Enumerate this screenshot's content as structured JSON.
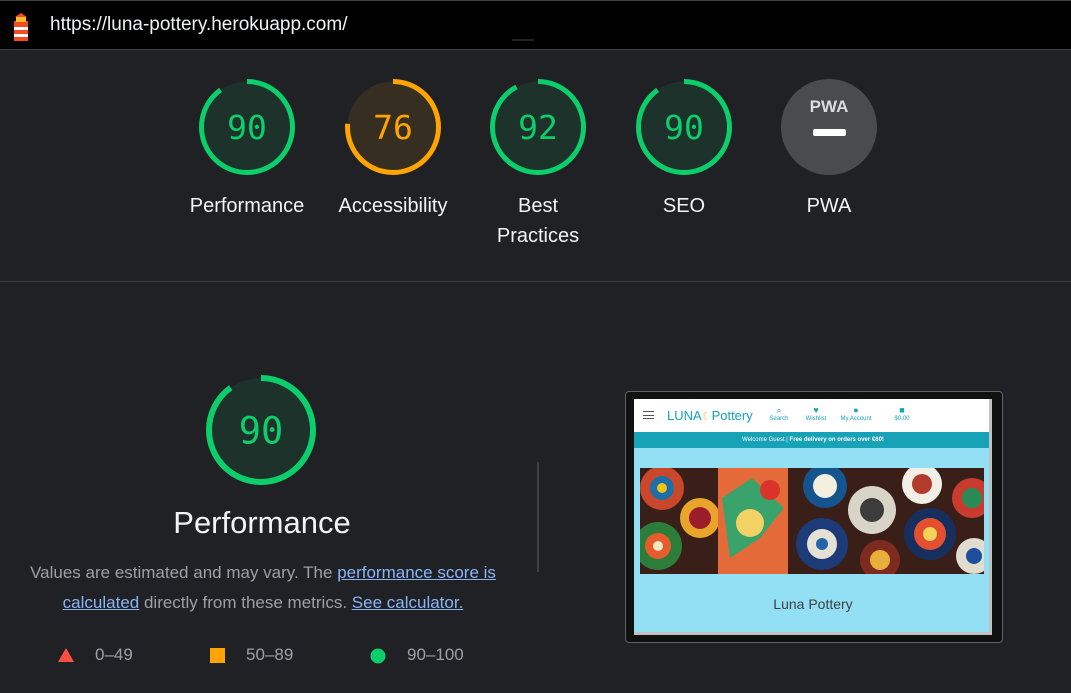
{
  "url_bar": {
    "url": "https://luna-pottery.herokuapp.com/"
  },
  "colors": {
    "pass": "#0cce6b",
    "average": "#ffa400",
    "fail": "#ff4e42",
    "pwa_bg": "#4a4b4e"
  },
  "gauges": [
    {
      "label": "Performance",
      "score": 90,
      "rating": "pass"
    },
    {
      "label": "Accessibility",
      "score": 76,
      "rating": "average"
    },
    {
      "label": "Best Practices",
      "score": 92,
      "rating": "pass"
    },
    {
      "label": "SEO",
      "score": 90,
      "rating": "pass"
    },
    {
      "label": "PWA",
      "badge_text": "PWA",
      "rating": "na"
    }
  ],
  "performance": {
    "score": 90,
    "title": "Performance",
    "desc_prefix": "Values are estimated and may vary. The ",
    "link_score": "performance score is calculated",
    "desc_middle": " directly from these metrics. ",
    "link_calc": "See calculator."
  },
  "legend": [
    {
      "range": "0–49",
      "shape": "triangle",
      "color": "#ff4e42"
    },
    {
      "range": "50–89",
      "shape": "square",
      "color": "#ffa400"
    },
    {
      "range": "90–100",
      "shape": "circle",
      "color": "#0cce6b"
    }
  ],
  "screenshot": {
    "logo_a": "LUNA",
    "logo_b": "Pottery",
    "nav": [
      {
        "icon": "search-icon",
        "label": "Search"
      },
      {
        "icon": "heart-icon",
        "label": "Wishlist"
      },
      {
        "icon": "user-icon",
        "label": "My Account"
      },
      {
        "icon": "bag-icon",
        "label": "$0.00"
      }
    ],
    "banner_a": "Welcome Guest | ",
    "banner_b": "Free delivery on orders over €60!",
    "caption": "Luna Pottery"
  }
}
